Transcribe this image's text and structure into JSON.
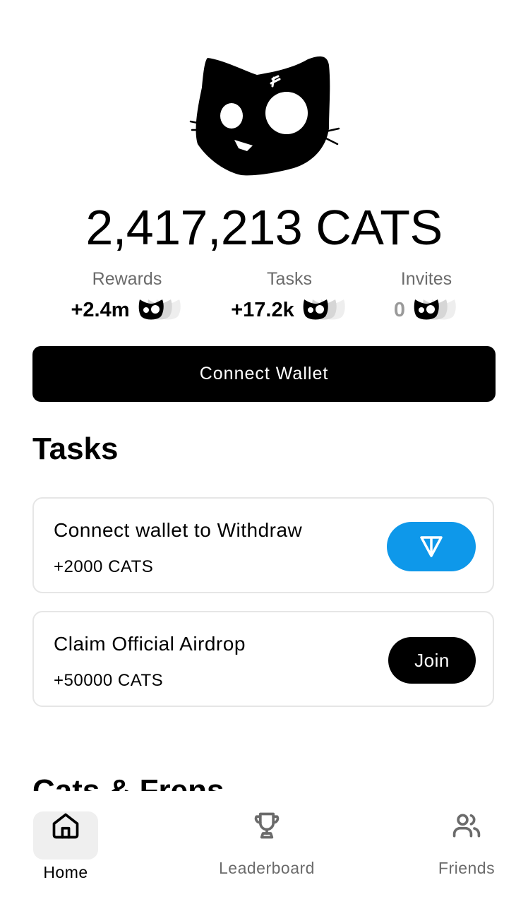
{
  "balance": {
    "amount": "2,417,213",
    "unit": "CATS"
  },
  "stats": [
    {
      "label": "Rewards",
      "value": "+2.4m"
    },
    {
      "label": "Tasks",
      "value": "+17.2k"
    },
    {
      "label": "Invites",
      "value": "0"
    }
  ],
  "connect_wallet_label": "Connect Wallet",
  "tasks_section": {
    "title": "Tasks",
    "items": [
      {
        "title": "Connect wallet to Withdraw",
        "reward": "+2000 CATS",
        "action_icon": "ton-icon"
      },
      {
        "title": "Claim Official Airdrop",
        "reward": "+50000 CATS",
        "action_label": "Join"
      }
    ]
  },
  "next_section_title": "Cats & Frens",
  "bottom_nav": [
    {
      "label": "Home",
      "icon": "home-icon",
      "active": true
    },
    {
      "label": "Leaderboard",
      "icon": "trophy-icon",
      "active": false
    },
    {
      "label": "Friends",
      "icon": "users-icon",
      "active": false
    }
  ],
  "colors": {
    "primary": "#000000",
    "ton_blue": "#0e98ea",
    "muted_text": "#6b6b6b",
    "card_border": "#e6e6e6"
  }
}
